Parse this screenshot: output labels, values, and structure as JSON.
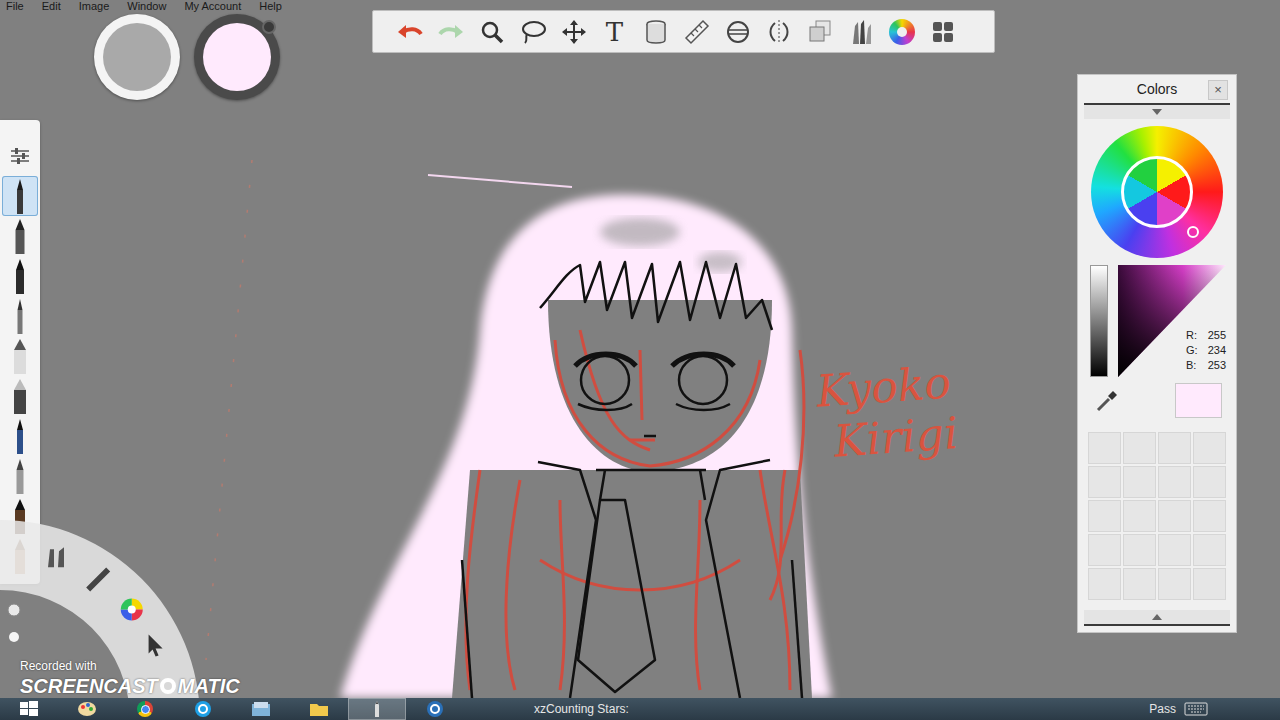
{
  "menu": [
    {
      "label": "File"
    },
    {
      "label": "Edit"
    },
    {
      "label": "Image"
    },
    {
      "label": "Window"
    },
    {
      "label": "My Account"
    },
    {
      "label": "Help"
    }
  ],
  "pucks": [
    {
      "kind": "size"
    },
    {
      "kind": "color"
    }
  ],
  "toolbar": [
    {
      "kind": "undo",
      "disabled": false
    },
    {
      "kind": "redo",
      "disabled": true
    },
    {
      "kind": "zoom",
      "disabled": false
    },
    {
      "kind": "lasso",
      "disabled": false
    },
    {
      "kind": "move",
      "disabled": false
    },
    {
      "kind": "text",
      "disabled": false,
      "glyph": "T"
    },
    {
      "kind": "fill",
      "disabled": false
    },
    {
      "kind": "ruler",
      "disabled": false
    },
    {
      "kind": "ellipse",
      "disabled": false
    },
    {
      "kind": "symmetry",
      "disabled": false
    },
    {
      "kind": "layers",
      "disabled": false
    },
    {
      "kind": "brushes",
      "disabled": false
    },
    {
      "kind": "color-wheel",
      "disabled": false
    },
    {
      "kind": "grid",
      "disabled": false
    }
  ],
  "brush_palette": [
    {
      "kind": "settings",
      "selected": false
    },
    {
      "kind": "pencil",
      "selected": true
    },
    {
      "kind": "marker",
      "selected": false
    },
    {
      "kind": "felt-pen",
      "selected": false
    },
    {
      "kind": "ballpoint",
      "selected": false
    },
    {
      "kind": "eraser",
      "selected": false
    },
    {
      "kind": "soft-eraser",
      "selected": false
    },
    {
      "kind": "ink-pen",
      "selected": false
    },
    {
      "kind": "airbrush",
      "selected": false
    },
    {
      "kind": "paintbrush",
      "selected": false
    },
    {
      "kind": "smudge",
      "selected": false
    }
  ],
  "lagoon": [
    {
      "kind": "brush-tools"
    },
    {
      "kind": "brush"
    },
    {
      "kind": "color-wheel"
    },
    {
      "kind": "select"
    }
  ],
  "canvas": {
    "caption": [
      "Kyoko",
      "Kirigi"
    ]
  },
  "colors_panel": {
    "title": "Colors",
    "close": "×",
    "channels": [
      {
        "label": "R:",
        "value": "255"
      },
      {
        "label": "G:",
        "value": "234"
      },
      {
        "label": "B:",
        "value": "253"
      }
    ],
    "swatches": [
      {
        "filled": false
      },
      {
        "filled": false
      },
      {
        "filled": false
      },
      {
        "filled": false
      },
      {
        "filled": false
      },
      {
        "filled": false
      },
      {
        "filled": false
      },
      {
        "filled": false
      },
      {
        "filled": false
      },
      {
        "filled": false
      },
      {
        "filled": false
      },
      {
        "filled": false
      },
      {
        "filled": false
      },
      {
        "filled": false
      },
      {
        "filled": false
      },
      {
        "filled": false
      },
      {
        "filled": false
      },
      {
        "filled": false
      },
      {
        "filled": false
      },
      {
        "filled": false
      }
    ]
  },
  "watermark": {
    "caption": "Recorded with",
    "brand_left": "SCREENCAST",
    "brand_right": "MATIC"
  },
  "taskbar": {
    "items": [
      {
        "kind": "start",
        "selected": false
      },
      {
        "kind": "paint",
        "selected": false
      },
      {
        "kind": "chrome",
        "selected": false
      },
      {
        "kind": "skype",
        "selected": false
      },
      {
        "kind": "explorer",
        "selected": false
      },
      {
        "kind": "folder",
        "selected": false
      },
      {
        "kind": "sketchbook",
        "selected": true
      },
      {
        "kind": "screencast",
        "selected": false
      }
    ],
    "window_title": "xzCounting Stars:",
    "tray_label": "Pass"
  }
}
